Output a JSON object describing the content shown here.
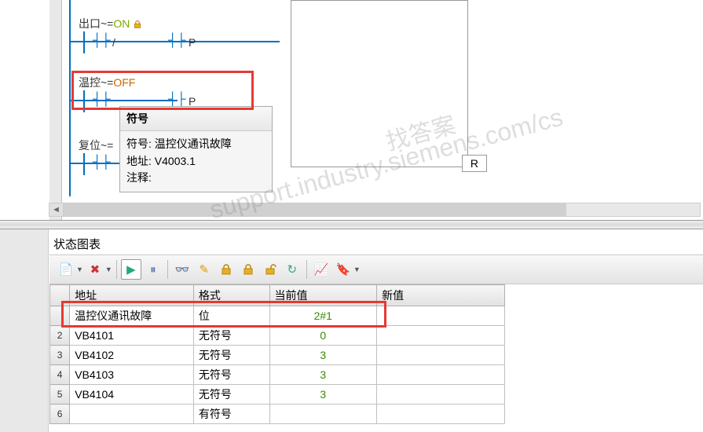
{
  "ladder": {
    "rung1": {
      "label": "出口~=",
      "state": "ON",
      "op1": "/",
      "op2": "P"
    },
    "rung2": {
      "label": "温控~=",
      "state": "OFF",
      "op2_partial": "P"
    },
    "rung3": {
      "label": "复位~="
    },
    "output_coil": "R"
  },
  "tooltip": {
    "header": "符号",
    "symbol_label": "符号:",
    "symbol_value": "温控仪通讯故障",
    "addr_label": "地址:",
    "addr_value": "V4003.1",
    "comment_label": "注释:",
    "comment_value": ""
  },
  "status_panel": {
    "title": "状态图表",
    "columns": {
      "addr": "地址",
      "format": "格式",
      "current": "当前值",
      "new": "新值"
    },
    "rows": [
      {
        "n": "",
        "addr": "温控仪通讯故障",
        "fmt": "位",
        "cur": "2#1",
        "new": ""
      },
      {
        "n": "2",
        "addr": "VB4101",
        "fmt": "无符号",
        "cur": "0",
        "new": ""
      },
      {
        "n": "3",
        "addr": "VB4102",
        "fmt": "无符号",
        "cur": "3",
        "new": ""
      },
      {
        "n": "4",
        "addr": "VB4103",
        "fmt": "无符号",
        "cur": "3",
        "new": ""
      },
      {
        "n": "5",
        "addr": "VB4104",
        "fmt": "无符号",
        "cur": "3",
        "new": ""
      },
      {
        "n": "6",
        "addr": "",
        "fmt": "有符号",
        "cur": "",
        "new": ""
      }
    ]
  },
  "watermark": {
    "url": "support.industry.siemens.com/cs",
    "text": "找答案"
  }
}
